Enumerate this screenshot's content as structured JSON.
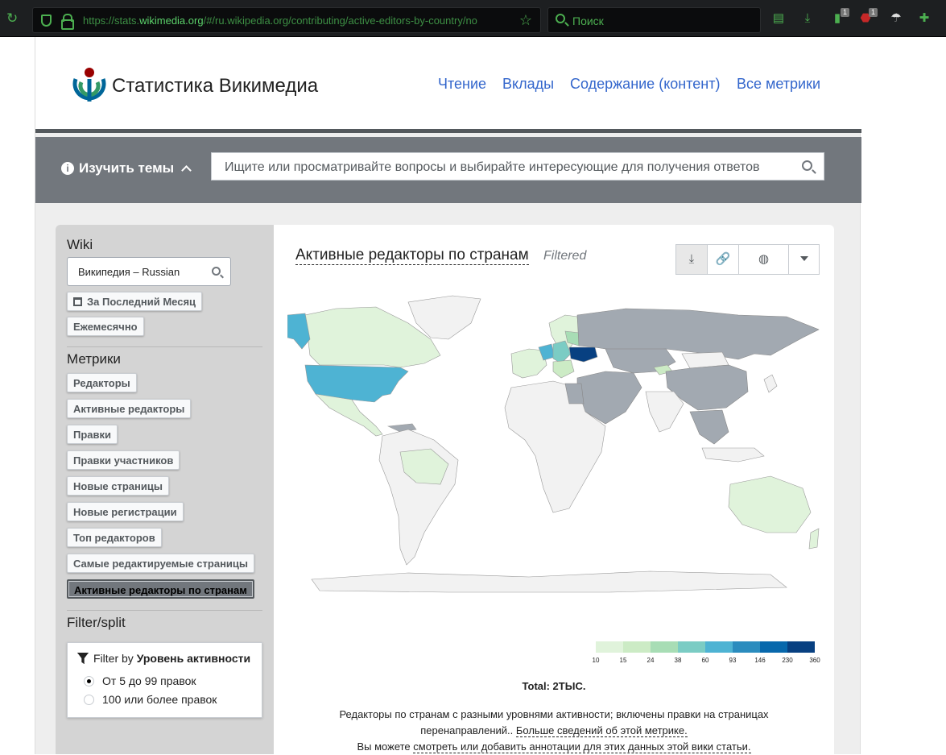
{
  "browser": {
    "url_prefix": "https://stats.",
    "url_domain": "wikimedia.org",
    "url_rest": "/#/ru.wikipedia.org/contributing/active-editors-by-country/no",
    "search_placeholder": "Поиск",
    "badge_1": "1",
    "badge_2": "1"
  },
  "header": {
    "brand": "Статистика Викимедиа",
    "nav": [
      "Чтение",
      "Вклады",
      "Содержание (контент)",
      "Все метрики"
    ]
  },
  "topics": {
    "label": "Изучить темы",
    "info_glyph": "i",
    "search_placeholder": "Ищите или просматривайте вопросы и выбирайте интересующие для получения ответов"
  },
  "sidebar": {
    "wiki_heading": "Wiki",
    "wiki_value": "Википедия – Russian",
    "range_button": "За Последний Месяц",
    "granularity_button": "Ежемесячно",
    "metrics_heading": "Метрики",
    "metrics": [
      "Редакторы",
      "Активные редакторы",
      "Правки",
      "Правки участников",
      "Новые страницы",
      "Новые регистрации",
      "Топ редакторов",
      "Самые редактируемые страницы",
      "Активные редакторы по странам"
    ],
    "active_metric_index": 8,
    "filter_heading": "Filter/split",
    "filter_by_prefix": "Filter by",
    "filter_by_name": "Уровень активности",
    "options": [
      {
        "label": "От 5 до 99 правок",
        "selected": true
      },
      {
        "label": "100 или более правок",
        "selected": false
      }
    ]
  },
  "card": {
    "title": "Активные редакторы по странам",
    "filtered_label": "Filtered",
    "legend": {
      "colors": [
        "#e0f3db",
        "#ccebc5",
        "#a8ddb5",
        "#7bccc4",
        "#4eb3d3",
        "#2b8cbe",
        "#0868ac",
        "#084081"
      ],
      "labels": [
        "10",
        "15",
        "24",
        "38",
        "60",
        "93",
        "146",
        "230",
        "360"
      ]
    },
    "total": "Total: 2ТЫС.",
    "desc_line1": "Редакторы по странам с разными уровнями активности; включены правки на страницах",
    "desc_line2_prefix": "перенаправлений.. ",
    "desc_line2_link": "Больше сведений об этой метрике.",
    "desc_line3_prefix": "Вы можете ",
    "desc_line3_link": "смотреть или добавить аннотации для этих данных этой вики статьи."
  },
  "colors": {
    "link": "#3366cc",
    "topicbar": "#72777d",
    "no_data_country": "#a2a9b1"
  }
}
